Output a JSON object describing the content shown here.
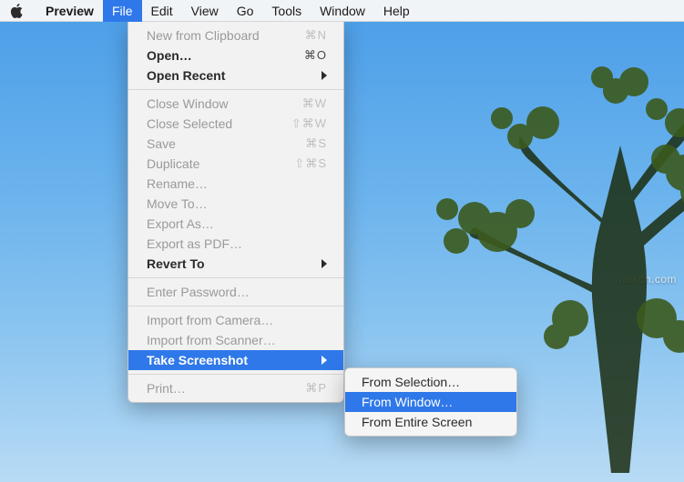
{
  "menubar": {
    "appname": "Preview",
    "items": [
      "File",
      "Edit",
      "View",
      "Go",
      "Tools",
      "Window",
      "Help"
    ],
    "active": "File"
  },
  "fileMenu": {
    "newFromClipboard": {
      "label": "New from Clipboard",
      "shortcut": "⌘N"
    },
    "open": {
      "label": "Open…",
      "shortcut": "⌘O"
    },
    "openRecent": {
      "label": "Open Recent"
    },
    "closeWindow": {
      "label": "Close Window",
      "shortcut": "⌘W"
    },
    "closeSelected": {
      "label": "Close Selected",
      "shortcut": "⇧⌘W"
    },
    "save": {
      "label": "Save",
      "shortcut": "⌘S"
    },
    "duplicate": {
      "label": "Duplicate",
      "shortcut": "⇧⌘S"
    },
    "rename": {
      "label": "Rename…"
    },
    "moveTo": {
      "label": "Move To…"
    },
    "exportAs": {
      "label": "Export As…"
    },
    "exportAsPDF": {
      "label": "Export as PDF…"
    },
    "revertTo": {
      "label": "Revert To"
    },
    "enterPassword": {
      "label": "Enter Password…"
    },
    "importFromCamera": {
      "label": "Import from Camera…"
    },
    "importFromScanner": {
      "label": "Import from Scanner…"
    },
    "takeScreenshot": {
      "label": "Take Screenshot"
    },
    "print": {
      "label": "Print…",
      "shortcut": "⌘P"
    }
  },
  "screenshotSubmenu": {
    "fromSelection": "From Selection…",
    "fromWindow": "From Window…",
    "fromEntireScreen": "From Entire Screen"
  },
  "watermark": "wsxdn.com"
}
